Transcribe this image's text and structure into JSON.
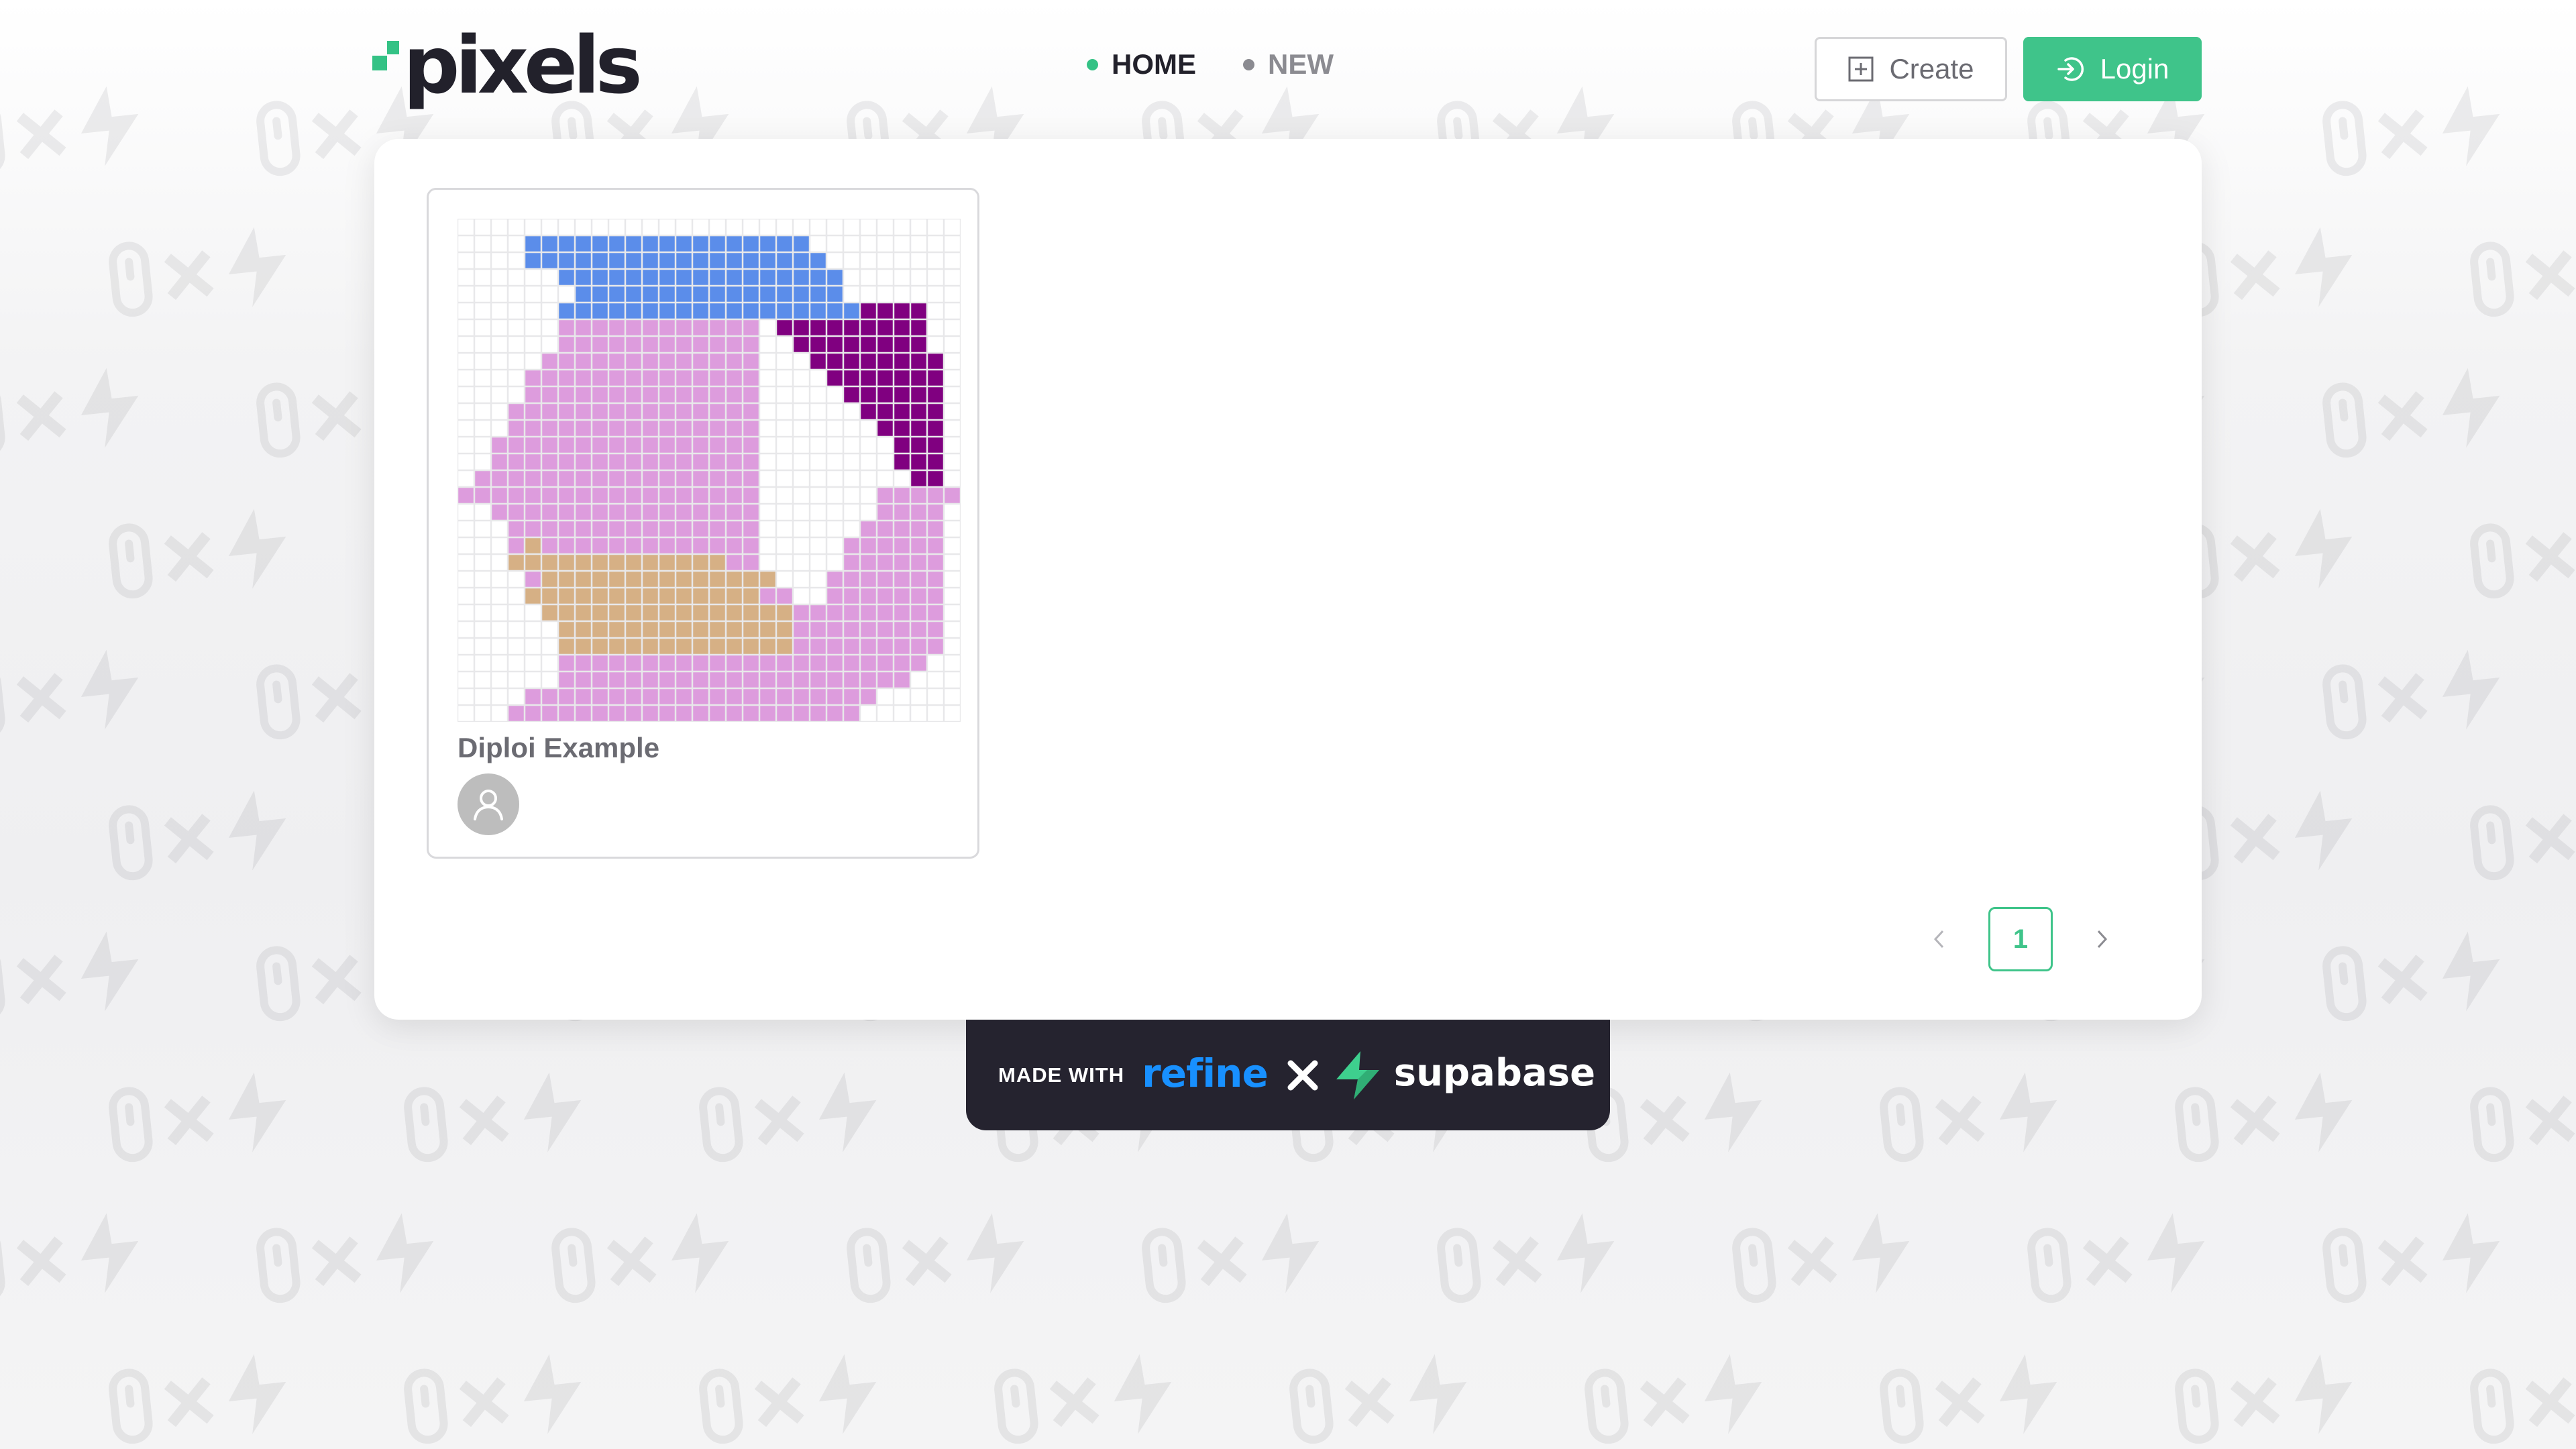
{
  "header": {
    "logo_text": "pixels",
    "nav": [
      {
        "label": "HOME",
        "active": true
      },
      {
        "label": "NEW",
        "active": false
      }
    ],
    "create_label": "Create",
    "login_label": "Login"
  },
  "canvases": [
    {
      "title": "Diploi Example",
      "grid": {
        "cols": 30,
        "rows": 30
      },
      "palette": {
        "B": "#5b8dea",
        "P": "#dd9cdd",
        "T": "#d6b085",
        "D": "#800080"
      },
      "pixels": [
        "..............................",
        "....BBBBBBBBBBBBBBBBB.........",
        "....BBBBBBBBBBBBBBBBBB........",
        "......BBBBBBBBBBBBBBBBB.......",
        ".......BBBBBBBBBBBBBBBB.......",
        "......BBBBBBBBBBBBBBBBBBDDDD..",
        "......PPPPPPPPPPPP.DDDDDDDDD..",
        "......PPPPPPPPPPPP..DDDDDDDD..",
        ".....PPPPPPPPPPPPP...DDDDDDDD.",
        "....PPPPPPPPPPPPPP....DDDDDDD.",
        "....PPPPPPPPPPPPPP.....DDDDDD.",
        "...PPPPPPPPPPPPPPP......DDDDD.",
        "...PPPPPPPPPPPPPPP.......DDDD.",
        "..PPPPPPPPPPPPPPPP........DDD.",
        "..PPPPPPPPPPPPPPPP........DDD.",
        ".PPPPPPPPPPPPPPPPP.........DD.",
        "PPPPPPPPPPPPPPPPPP.......PPPPP",
        "..PPPPPPPPPPPPPPPP.......PPPP.",
        "...PPPPPPPPPPPPPPP......PPPPP.",
        "...PTPPPPPPPPPPPPP.....PPPPPP.",
        "...TTTTTTTTTTTTTPP.....PPPPPP.",
        "....PTTTTTTTTTTTTTT...PPPPPPP.",
        "....TTTTTTTTTTTTTTPP..PPPPPPP.",
        ".....TTTTTTTTTTTTTTTPPPPPPPPP.",
        "......TTTTTTTTTTTTTTPPPPPPPPP.",
        "......TTTTTTTTTTTTTTPPPPPPPPP.",
        "......PPPPPPPPPPPPPPPPPPPPPP..",
        "......PPPPPPPPPPPPPPPPPPPPP...",
        "....PPPPPPPPPPPPPPPPPPPPP.....",
        "...PPPPPPPPPPPPPPPPPPPPP......"
      ]
    }
  ],
  "pagination": {
    "current_page": "1"
  },
  "footer": {
    "made_with": "MADE WITH",
    "refine": "refine",
    "supabase": "supabase"
  },
  "colors": {
    "accent": "#3fc48a",
    "text_dark": "#22212b",
    "text_muted": "#6b6b72",
    "refine_blue": "#1890ff",
    "banner_bg": "#25232f"
  }
}
